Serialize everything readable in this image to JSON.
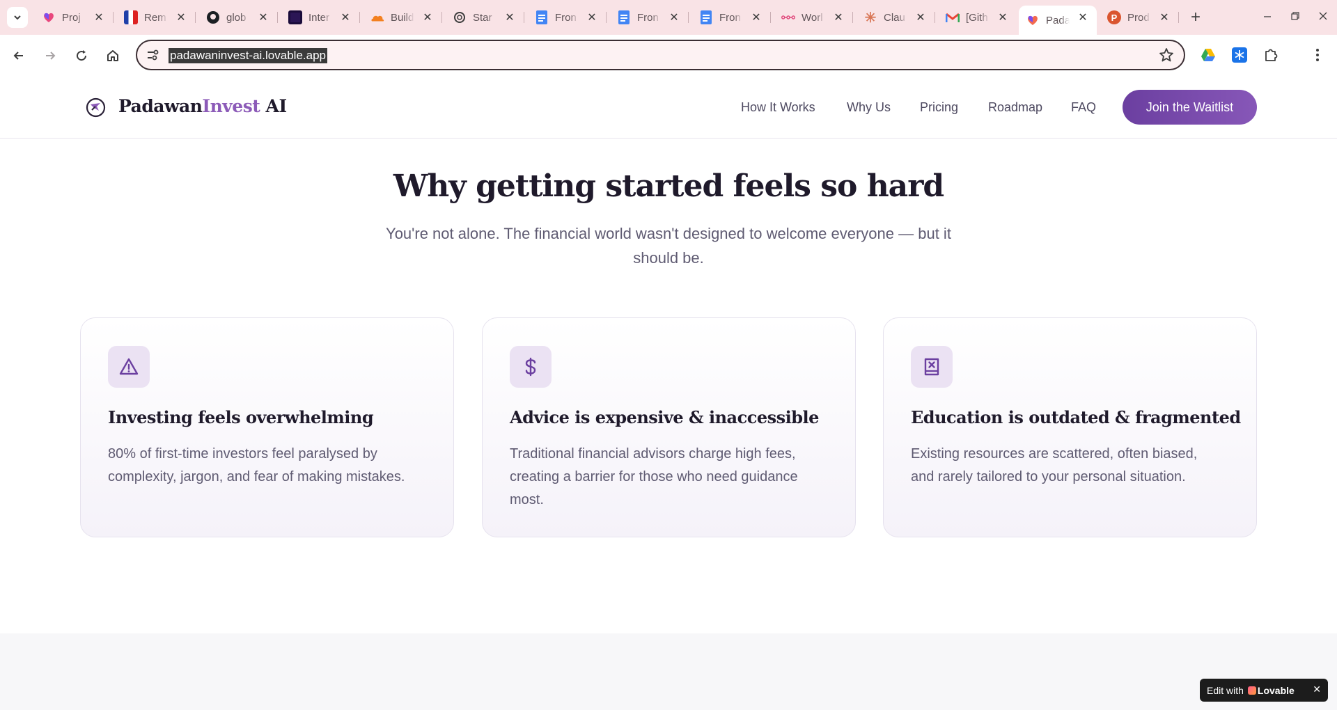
{
  "browser": {
    "tabs": [
      {
        "title": "Proj",
        "icon": "lovable-heart-icon"
      },
      {
        "title": "Rem",
        "icon": "flag-icon"
      },
      {
        "title": "glob",
        "icon": "github-icon"
      },
      {
        "title": "Inter",
        "icon": "square-logo-icon"
      },
      {
        "title": "Build",
        "icon": "cloudflare-icon"
      },
      {
        "title": "Star",
        "icon": "openai-icon"
      },
      {
        "title": "Fron",
        "icon": "google-docs-icon"
      },
      {
        "title": "Fron",
        "icon": "google-docs-icon"
      },
      {
        "title": "Fron",
        "icon": "google-docs-icon"
      },
      {
        "title": "Worl",
        "icon": "workflow-icon"
      },
      {
        "title": "Clau",
        "icon": "claude-icon"
      },
      {
        "title": "[Gith",
        "icon": "gmail-icon"
      },
      {
        "title": "Pada",
        "icon": "lovable-heart-icon",
        "active": true
      },
      {
        "title": "Prod",
        "icon": "producthunt-icon"
      }
    ],
    "address": "padawaninvest-ai.lovable.app"
  },
  "header": {
    "brand_primary": "Padawan",
    "brand_accent": "Invest",
    "brand_suffix": " AI",
    "nav": [
      "How It Works",
      "Why Us",
      "Pricing",
      "Roadmap",
      "FAQ"
    ],
    "cta": "Join the Waitlist"
  },
  "hero": {
    "title": "Why getting started feels so hard",
    "subtitle": "You're not alone. The financial world wasn't designed to welcome everyone — but it should be."
  },
  "cards": [
    {
      "icon": "warning-triangle-icon",
      "title": "Investing feels overwhelming",
      "text": "80% of first-time investors feel paralysed by complexity, jargon, and fear of making mistakes."
    },
    {
      "icon": "dollar-sign-icon",
      "title": "Advice is expensive & inaccessible",
      "text": "Traditional financial advisors charge high fees, creating a barrier for those who need guidance most."
    },
    {
      "icon": "book-x-icon",
      "title": "Education is outdated & fragmented",
      "text": "Existing resources are scattered, often biased, and rarely tailored to your personal situation."
    }
  ],
  "badge": {
    "prefix": "Edit with",
    "name": "Lovable"
  },
  "colors": {
    "accent": "#6b3fa0",
    "accent_light": "#8c5bb8",
    "tabstrip": "#f9e3e6"
  }
}
